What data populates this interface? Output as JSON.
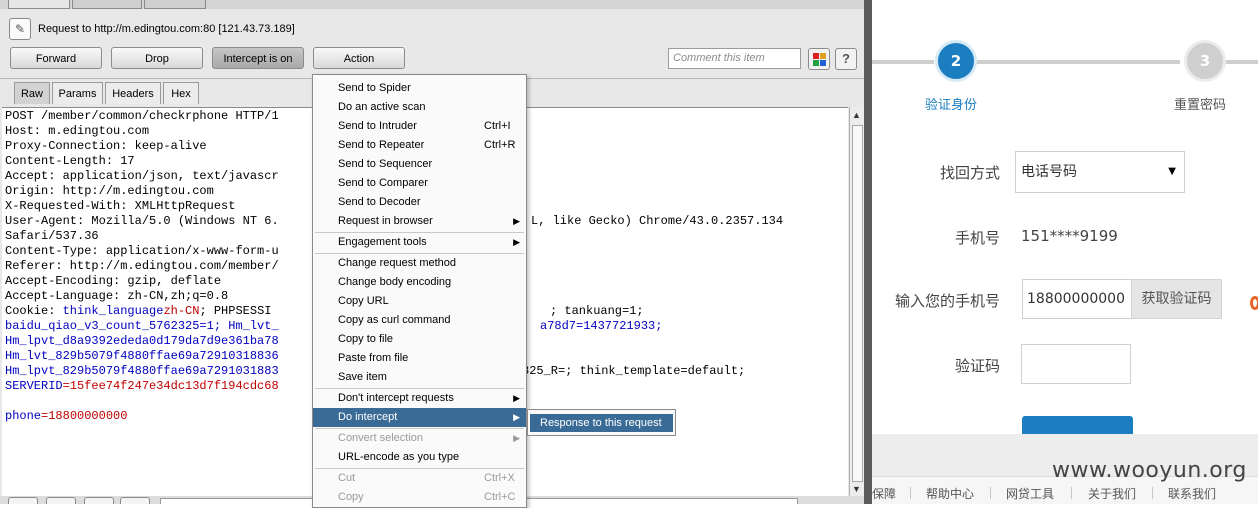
{
  "burp": {
    "request_line": "Request to http://m.edingtou.com:80  [121.43.73.189]",
    "buttons": {
      "forward": "Forward",
      "drop": "Drop",
      "intercept": "Intercept is on",
      "action": "Action"
    },
    "comment_placeholder": "Comment this item",
    "help": "?",
    "view_tabs": [
      "Raw",
      "Params",
      "Headers",
      "Hex"
    ],
    "selected_tab": "Raw",
    "request_lines": [
      "POST /member/common/checkrphone HTTP/1",
      "Host: m.edingtou.com",
      "Proxy-Connection: keep-alive",
      "Content-Length: 17",
      "Accept: application/json, text/javascr",
      "Origin: http://m.edingtou.com",
      "X-Requested-With: XMLHttpRequest",
      "User-Agent: Mozilla/5.0 (Windows NT 6.",
      "Safari/537.36",
      "Content-Type: application/x-www-form-u",
      "Referer: http://m.edingtou.com/member/",
      "Accept-Encoding: gzip, deflate",
      "Accept-Language: zh-CN,zh;q=0.8"
    ],
    "user_agent_tail": "L, like Gecko) Chrome/43.0.2357.134",
    "cookie": {
      "prefix": "Cookie: ",
      "think_language_key": "think_language",
      "think_language_val": "zh-CN",
      "phpsess_key": "; PHPSESSI",
      "tankuang_tail": "; tankuang=1;",
      "baidu_line": "baidu_qiao_v3_count_5762325=1; Hm_lvt_",
      "baidu_tail": "a78d7=1437721933;",
      "hm1": "Hm_lpvt_d8a9392ededa0d179da7d9e361ba78",
      "hm2": "Hm_lvt_829b5079f4880ffae69a72910318836",
      "hm3": "Hm_lpvt_829b5079f4880ffae69a7291031883",
      "hm3_tail": "825_R=; think_template=default;",
      "serverid_key": "SERVERID",
      "serverid_val": "=15fee74f247e34dc13d7f194cdc68"
    },
    "body": {
      "key": "phone",
      "val": "=18800000000"
    }
  },
  "menu": {
    "items": [
      {
        "label": "Send to Spider",
        "shortcut": "",
        "arrow": false,
        "disabled": false
      },
      {
        "label": "Do an active scan",
        "shortcut": "",
        "arrow": false,
        "disabled": false
      },
      {
        "label": "Send to Intruder",
        "shortcut": "Ctrl+I",
        "arrow": false,
        "disabled": false
      },
      {
        "label": "Send to Repeater",
        "shortcut": "Ctrl+R",
        "arrow": false,
        "disabled": false
      },
      {
        "label": "Send to Sequencer",
        "shortcut": "",
        "arrow": false,
        "disabled": false
      },
      {
        "label": "Send to Comparer",
        "shortcut": "",
        "arrow": false,
        "disabled": false
      },
      {
        "label": "Send to Decoder",
        "shortcut": "",
        "arrow": false,
        "disabled": false
      },
      {
        "label": "Request in browser",
        "shortcut": "",
        "arrow": true,
        "disabled": false
      },
      {
        "label": "Engagement tools",
        "shortcut": "",
        "arrow": true,
        "disabled": false
      },
      {
        "label": "Change request method",
        "shortcut": "",
        "arrow": false,
        "disabled": false
      },
      {
        "label": "Change body encoding",
        "shortcut": "",
        "arrow": false,
        "disabled": false
      },
      {
        "label": "Copy URL",
        "shortcut": "",
        "arrow": false,
        "disabled": false
      },
      {
        "label": "Copy as curl command",
        "shortcut": "",
        "arrow": false,
        "disabled": false
      },
      {
        "label": "Copy to file",
        "shortcut": "",
        "arrow": false,
        "disabled": false
      },
      {
        "label": "Paste from file",
        "shortcut": "",
        "arrow": false,
        "disabled": false
      },
      {
        "label": "Save item",
        "shortcut": "",
        "arrow": false,
        "disabled": false
      },
      {
        "label": "Don't intercept requests",
        "shortcut": "",
        "arrow": true,
        "disabled": false
      },
      {
        "label": "Do intercept",
        "shortcut": "",
        "arrow": true,
        "disabled": false,
        "highlighted": true
      },
      {
        "label": "Convert selection",
        "shortcut": "",
        "arrow": true,
        "disabled": true
      },
      {
        "label": "URL-encode as you type",
        "shortcut": "",
        "arrow": false,
        "disabled": false
      },
      {
        "label": "Cut",
        "shortcut": "Ctrl+X",
        "arrow": false,
        "disabled": true
      },
      {
        "label": "Copy",
        "shortcut": "Ctrl+C",
        "arrow": false,
        "disabled": true
      }
    ],
    "submenu_item": "Response to this request"
  },
  "web": {
    "steps": [
      {
        "number": "2",
        "label": "验证身份",
        "active": true
      },
      {
        "number": "3",
        "label": "重置密码",
        "active": false
      }
    ],
    "fields": {
      "method_label": "找回方式",
      "method_value": "电话号码",
      "phone_label": "手机号",
      "phone_value": "151****9199",
      "input_phone_label": "输入您的手机号",
      "input_phone_value": "18800000000",
      "get_code_button": "获取验证码",
      "code_label": "验证码"
    },
    "footer_links": [
      "保障",
      "帮助中心",
      "网贷工具",
      "关于我们",
      "联系我们"
    ],
    "watermark": "www.wooyun.org"
  },
  "colors": {
    "accent_blue": "#1a7ec0",
    "menu_highlight": "#3a6b96",
    "keyword_blue": "#0000c0",
    "value_red": "#c00000"
  }
}
